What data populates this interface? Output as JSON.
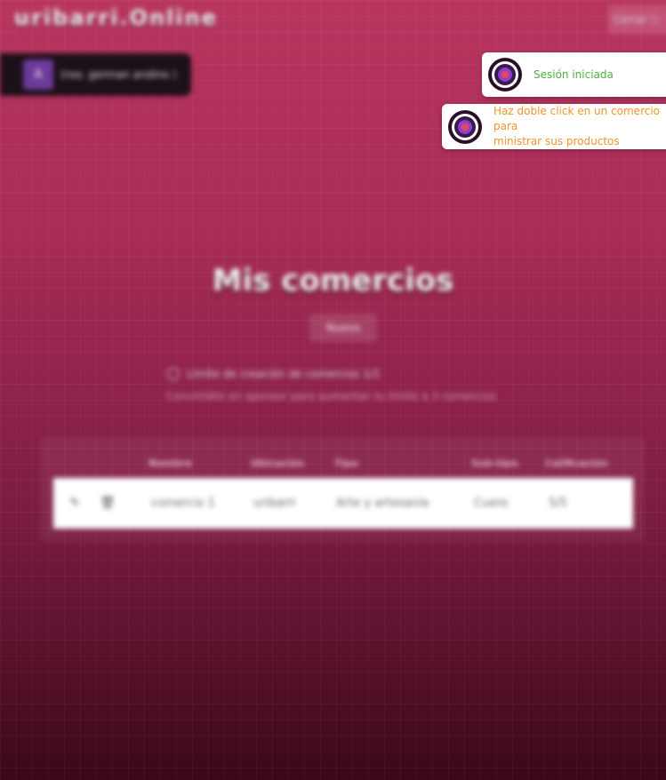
{
  "header": {
    "brand": "uribarri.Online",
    "logout_label": "Cerrar ⎋"
  },
  "user": {
    "avatar_initial": "A",
    "name": "(roo. german andino ⟩"
  },
  "main": {
    "title": "Mis comercios",
    "add_button": "Nuevo",
    "limit_text": "Límite de creación de comercios 1/1",
    "sponsor_text": "Convirtiéte en sponsor para aumentar tu límite a 3 comercios",
    "table": {
      "columns": [
        "Nombre",
        "Ubicación",
        "Tipo",
        "Sub-tipo",
        "Calificación"
      ],
      "rows": [
        {
          "nombre": "comercio 1",
          "ubicacion": "uribarri",
          "tipo": "Arte y artesanía",
          "subtipo": "Cuero",
          "calificacion": "5/5"
        }
      ]
    }
  },
  "toasts": [
    {
      "text": "Sesión iniciada",
      "color": "#4ab33a"
    },
    {
      "text": "Haz doble click en un comercio para\nministrar sus productos",
      "color": "#f0952b"
    }
  ]
}
